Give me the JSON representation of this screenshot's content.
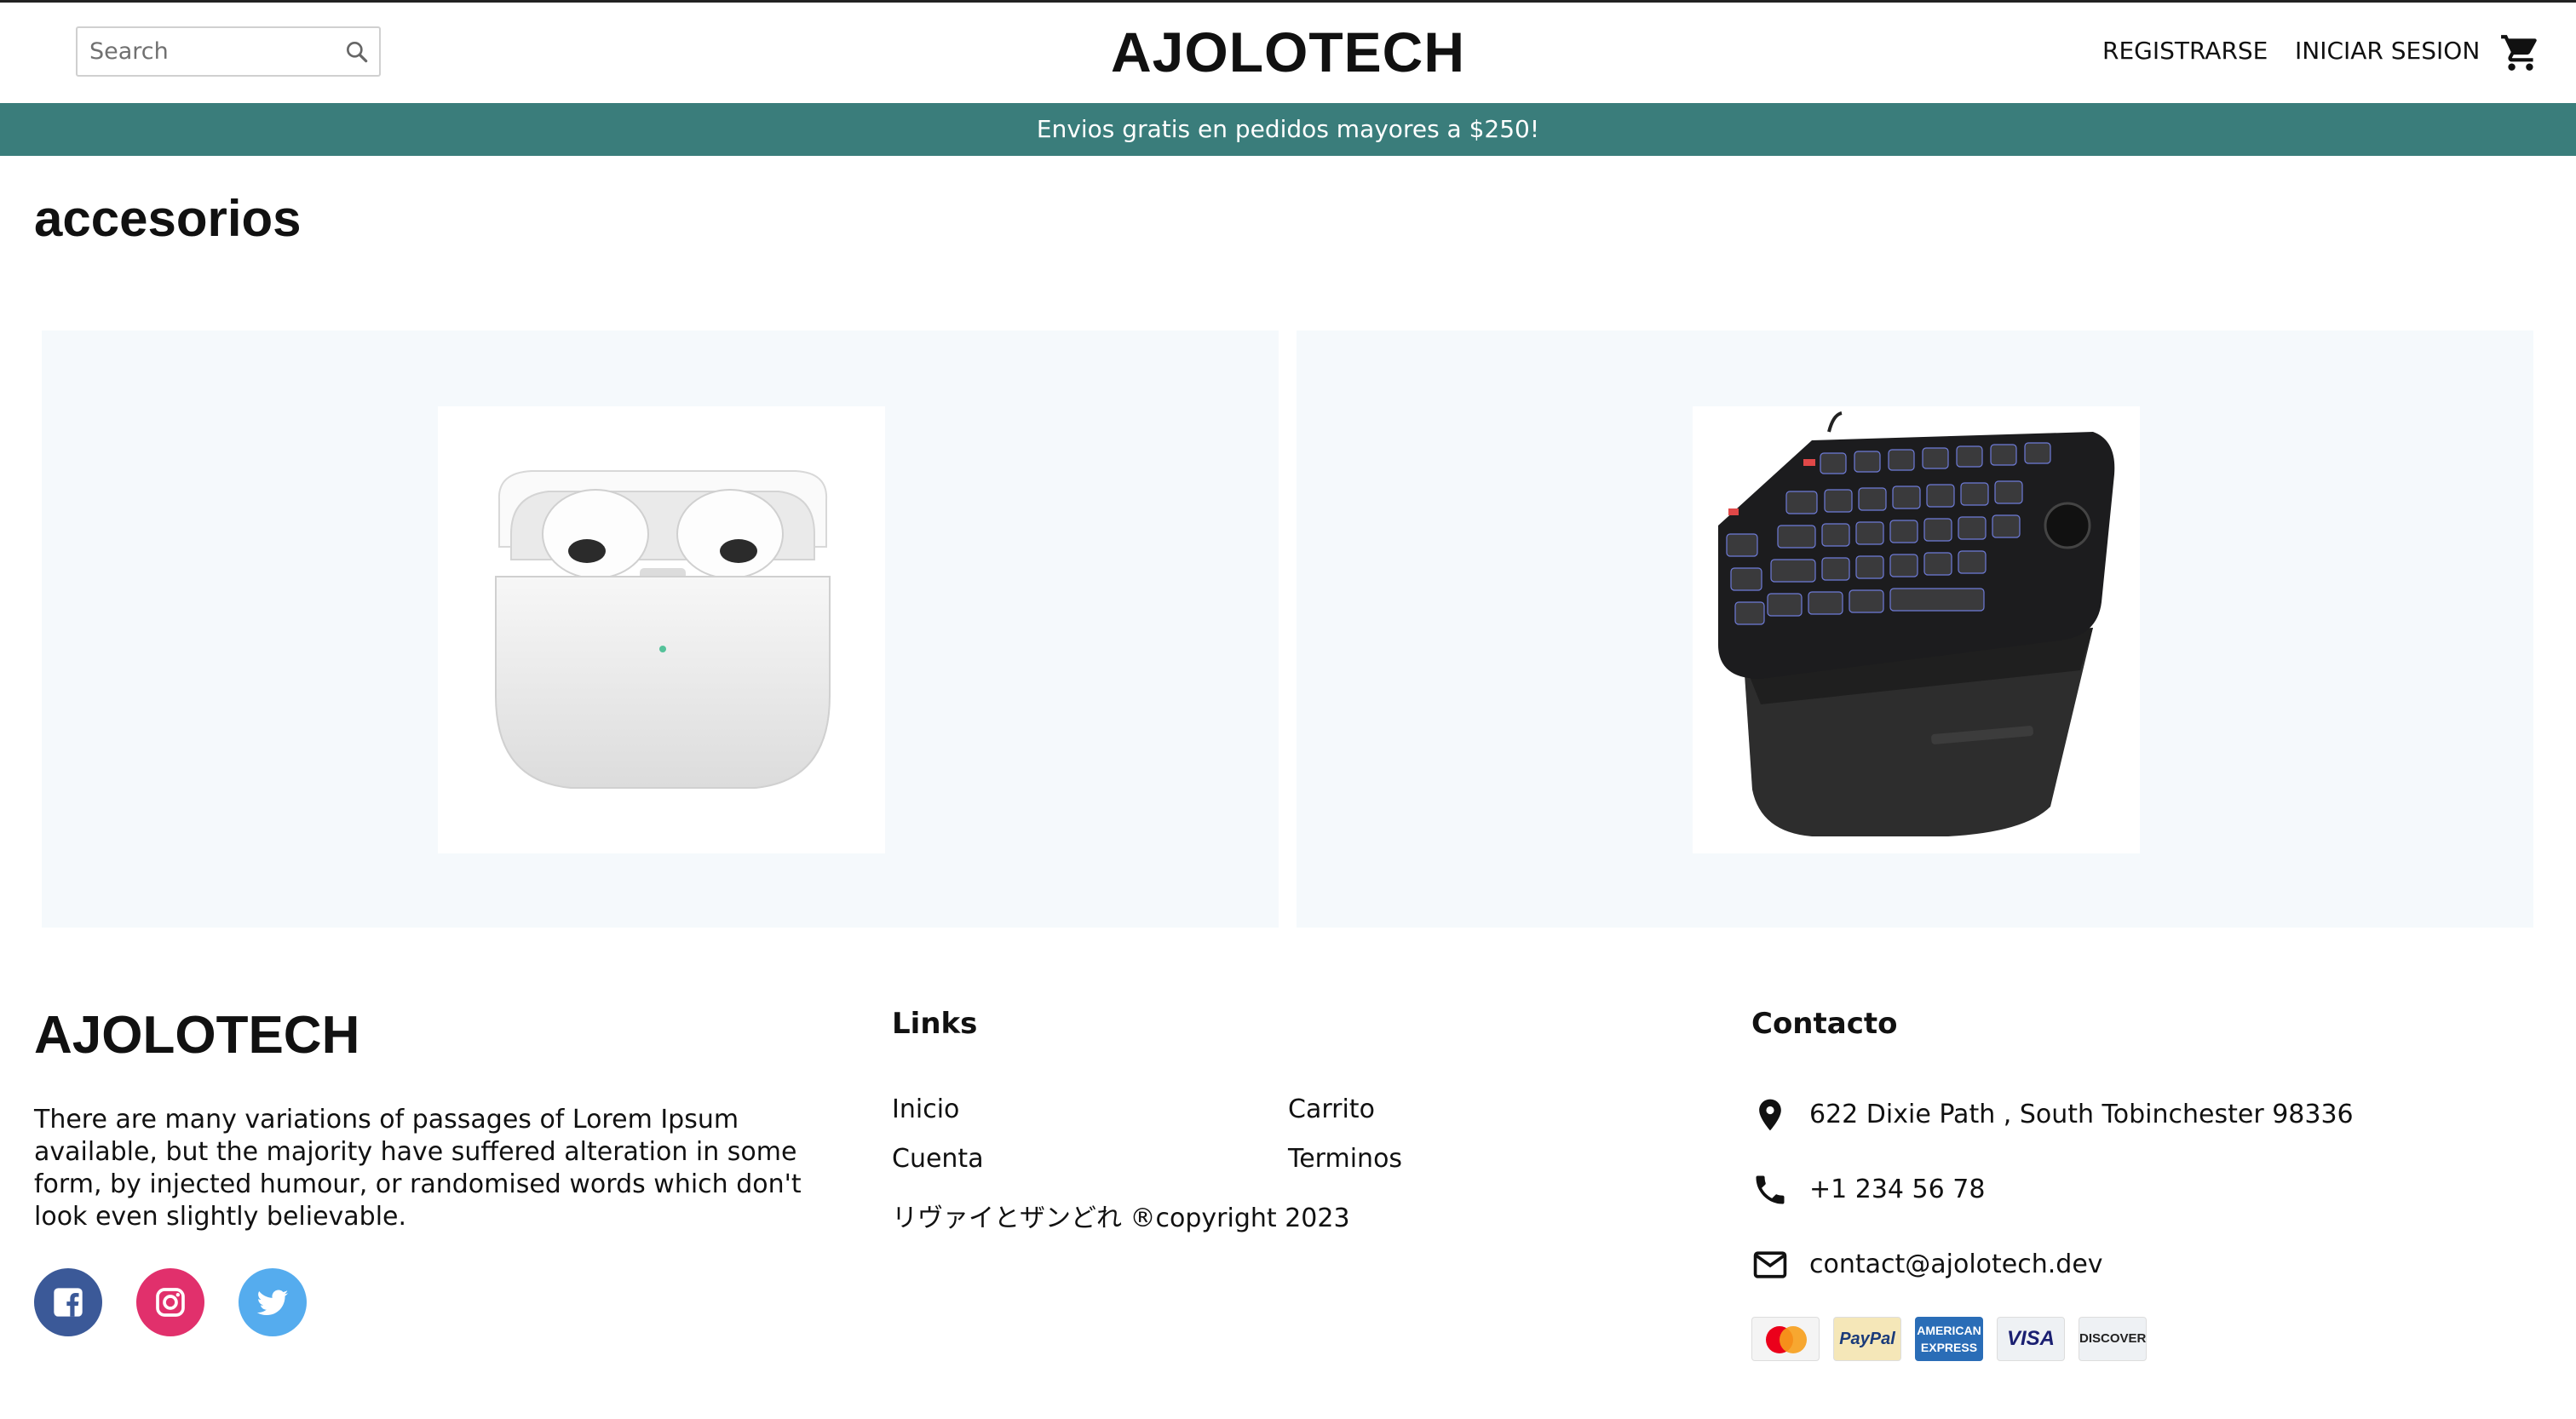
{
  "header": {
    "search_placeholder": "Search",
    "logo": "AJOLOTECH",
    "nav": {
      "register": "REGISTRARSE",
      "login": "INICIAR SESION"
    }
  },
  "promo_text": "Envios gratis en pedidos mayores a $250!",
  "category": {
    "title": "accesorios",
    "products": [
      {
        "image": "airpods-image"
      },
      {
        "image": "gaming-keypad-image"
      }
    ]
  },
  "footer": {
    "logo": "AJOLOTECH",
    "description": "There are many variations of passages of Lorem Ipsum available, but the majority have suffered alteration in some form, by injected humour, or randomised words which don't look even slightly believable.",
    "links_heading": "Links",
    "links": {
      "inicio": "Inicio",
      "carrito": "Carrito",
      "cuenta": "Cuenta",
      "terminos": "Terminos"
    },
    "copyright": "リヴァイとザンどれ ®copyright 2023",
    "contact_heading": "Contacto",
    "contact": {
      "address": "622 Dixie Path , South Tobinchester 98336",
      "phone": "+1 234 56 78",
      "email": "contact@ajolotech.dev"
    },
    "payments": {
      "paypal": "PayPal",
      "amex": "AMERICAN EXPRESS",
      "visa": "VISA",
      "discover": "DISCOVER"
    },
    "social": [
      "facebook-icon",
      "instagram-icon",
      "twitter-icon"
    ]
  },
  "colors": {
    "promo_bg": "#3a7d7b",
    "card_bg": "#f5f9fc",
    "facebook": "#3b5998",
    "instagram": "#e1306c",
    "twitter": "#55acee"
  }
}
